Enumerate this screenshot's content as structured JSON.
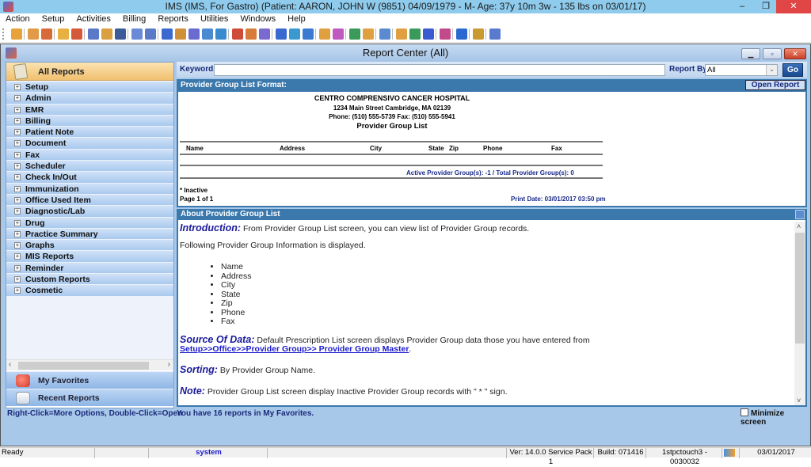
{
  "window": {
    "title": "IMS (IMS, For Gastro)    (Patient: AARON, JOHN W (9851) 04/09/1979 - M- Age: 37y 10m 3w - 135 lbs on 03/01/17)",
    "minimize": "–",
    "maximize": "❐",
    "close": "✕"
  },
  "menu": [
    "Action",
    "Setup",
    "Activities",
    "Billing",
    "Reports",
    "Utilities",
    "Windows",
    "Help"
  ],
  "toolbar_icons": [
    "patient-icon",
    "doctor-icon",
    "doctor-check-icon",
    "folder-icon",
    "edit-note-icon",
    "prescription-icon",
    "lab-flask-icon",
    "shield-icon",
    "document-icon",
    "notes-icon",
    "billing-icon",
    "billing-2-icon",
    "claims-icon",
    "payment-icon",
    "payment-2-icon",
    "calendar-grid-icon",
    "people-icon",
    "letter-icon",
    "fax-icon",
    "email-icon",
    "email-2-icon",
    "schedule-icon",
    "schedule-check-icon",
    "report-chart-icon",
    "folder-user-icon",
    "reports-icon",
    "transfer-icon",
    "transfer-2-icon",
    "word-icon",
    "message-icon",
    "help-icon",
    "lock-icon",
    "exit-icon"
  ],
  "report_center": {
    "title": "Report Center (All)",
    "min": "▁",
    "restore": "▫",
    "close": "✕",
    "all_reports": "All Reports",
    "tree": [
      "Setup",
      "Admin",
      "EMR",
      "Billing",
      "Patient Note",
      "Document",
      "Fax",
      "Scheduler",
      "Check In/Out",
      "Immunization",
      "Office Used Item",
      "Diagnostic/Lab",
      "Drug",
      "Practice Summary",
      "Graphs",
      "MIS Reports",
      "Reminder",
      "Custom Reports",
      "Cosmetic"
    ],
    "my_favorites": "My Favorites",
    "recent_reports": "Recent Reports",
    "left_hint": "Right-Click=More Options, Double-Click=Open",
    "fav_hint": "You have 16 reports in My Favorites.",
    "keywords_label": "Keywords:",
    "keywords_value": "",
    "report_by_label": "Report By:",
    "report_by_value": "All",
    "go": "Go",
    "format_header": "Provider Group List Format:",
    "open_report": "Open Report",
    "minimize_screen": "Minimize screen",
    "minimize_checked": false
  },
  "report": {
    "org": "CENTRO COMPRENSIVO CANCER HOSPITAL",
    "address": "1234 Main Street    Cambridge, MA 02139",
    "phone": "Phone: (510) 555-5739  Fax: (510) 555-5941",
    "title": "Provider Group List",
    "columns": [
      "Name",
      "Address",
      "City",
      "State",
      "Zip",
      "Phone",
      "Fax"
    ],
    "totals": "Active Provider Group(s): -1 / Total Provider Group(s): 0",
    "inactive": "* Inactive",
    "page": "Page 1 of 1",
    "print_date": "Print Date: 03/01/2017 03:50 pm"
  },
  "about": {
    "header": "About Provider Group List",
    "intro_h": "Introduction:",
    "intro": " From Provider Group List screen, you can view list of Provider Group records.",
    "following": "Following Provider Group Information is displayed.",
    "fields": [
      "Name",
      "Address",
      "City",
      "State",
      "Zip",
      "Phone",
      "Fax"
    ],
    "source_h": "Source Of Data:",
    "source": " Default Prescription List screen displays Provider Group data those you have entered from",
    "source_link": "Setup>>Office>>Provider Group>> Provider Group Master",
    "source_end": ".",
    "sorting_h": "Sorting:",
    "sorting": " By Provider Group Name.",
    "note_h": "Note:",
    "note": " Provider Group List screen display Inactive Provider Group records with \" * \" sign."
  },
  "status": {
    "ready": "Ready",
    "user": "system",
    "version": "Ver: 14.0.0 Service Pack 1",
    "build": "Build: 071416",
    "station": "1stpctouch3 - 0030032",
    "date": "03/01/2017"
  }
}
